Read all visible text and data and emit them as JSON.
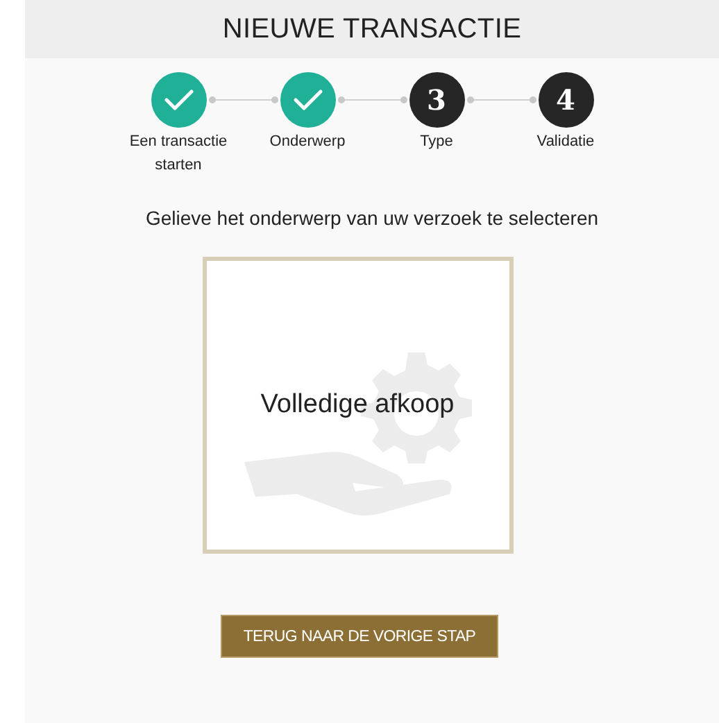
{
  "title": "NIEUWE TRANSACTIE",
  "steps": [
    {
      "label": "Een transactie starten",
      "completed": true
    },
    {
      "label": "Onderwerp",
      "completed": true
    },
    {
      "label": "Type",
      "completed": false,
      "number": "3"
    },
    {
      "label": "Validatie",
      "completed": false,
      "number": "4"
    }
  ],
  "instruction": "Gelieve het onderwerp van uw verzoek te selecteren",
  "options": [
    {
      "label": "Volledige afkoop"
    }
  ],
  "back_button": "TERUG NAAR DE VORIGE STAP"
}
